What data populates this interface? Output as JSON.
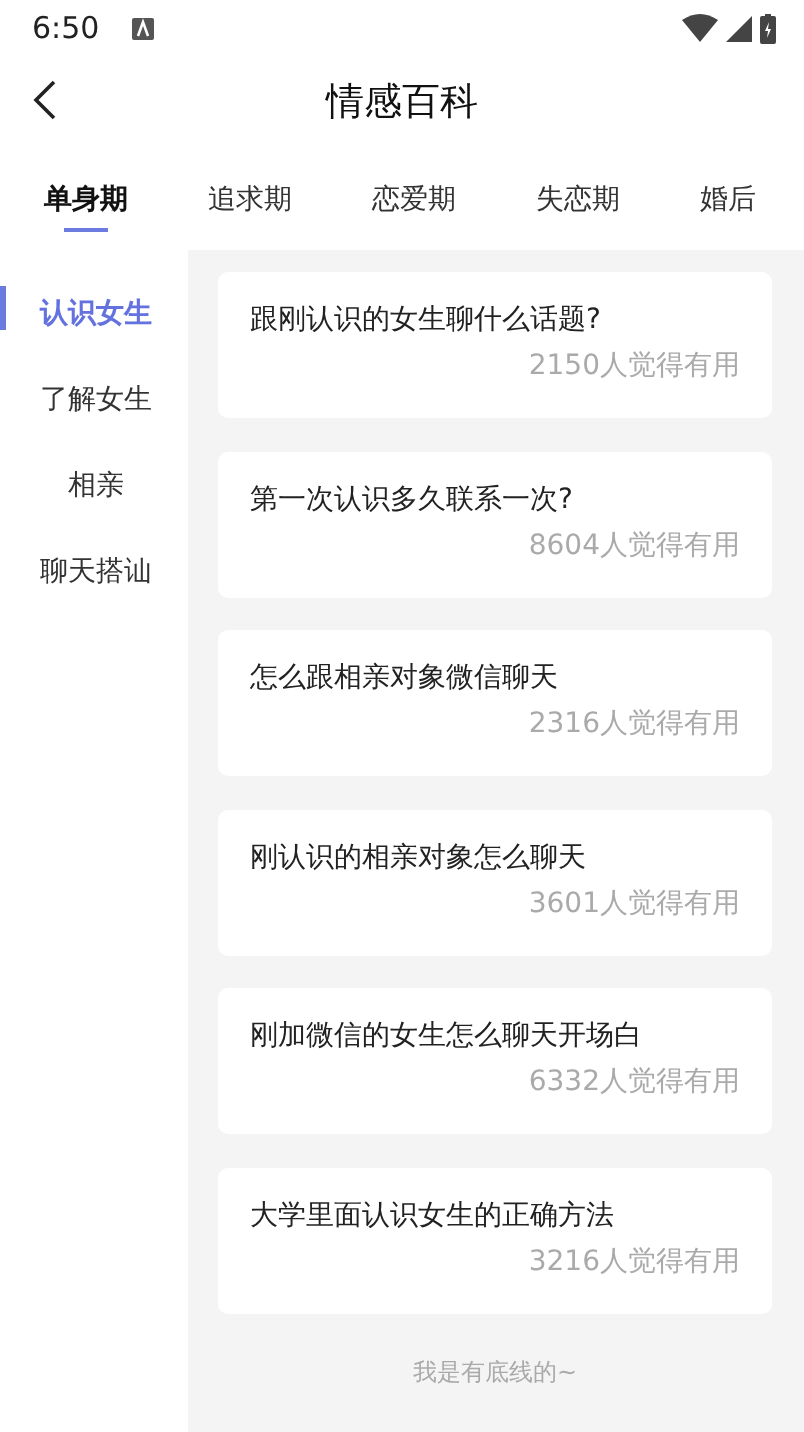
{
  "status_bar": {
    "time": "6:50"
  },
  "header": {
    "title": "情感百科"
  },
  "tabs": [
    {
      "label": "单身期",
      "selected": true
    },
    {
      "label": "追求期",
      "selected": false
    },
    {
      "label": "恋爱期",
      "selected": false
    },
    {
      "label": "失恋期",
      "selected": false
    },
    {
      "label": "婚后",
      "selected": false
    }
  ],
  "sidebar": {
    "items": [
      {
        "label": "认识女生",
        "selected": true
      },
      {
        "label": "了解女生",
        "selected": false
      },
      {
        "label": "相亲",
        "selected": false
      },
      {
        "label": "聊天搭讪",
        "selected": false
      }
    ]
  },
  "articles": [
    {
      "title": "跟刚认识的女生聊什么话题?",
      "count": "2150人觉得有用"
    },
    {
      "title": "第一次认识多久联系一次?",
      "count": "8604人觉得有用"
    },
    {
      "title": "怎么跟相亲对象微信聊天",
      "count": "2316人觉得有用"
    },
    {
      "title": "刚认识的相亲对象怎么聊天",
      "count": "3601人觉得有用"
    },
    {
      "title": "刚加微信的女生怎么聊天开场白",
      "count": "6332人觉得有用"
    },
    {
      "title": "大学里面认识女生的正确方法",
      "count": "3216人觉得有用"
    }
  ],
  "footer": "我是有底线的~"
}
